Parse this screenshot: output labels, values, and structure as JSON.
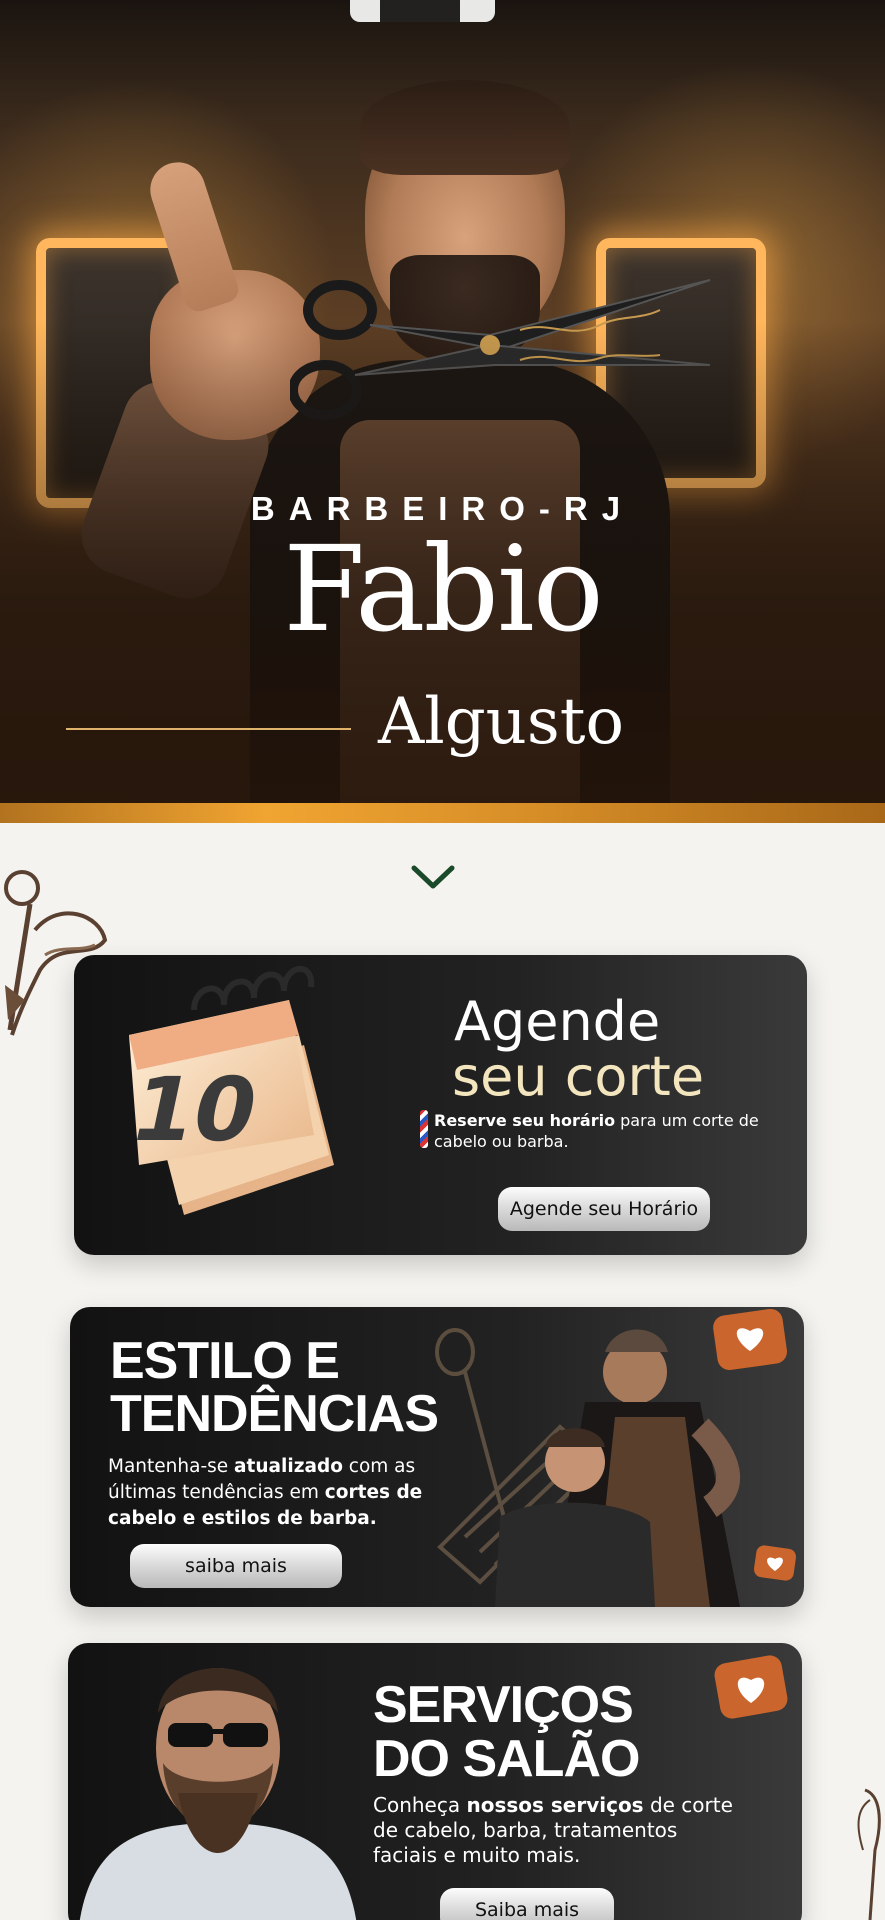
{
  "hero": {
    "kicker": "BARBEIRO-RJ",
    "title": "Fabio",
    "subtitle": "Algusto"
  },
  "scroll_indicator": {
    "icon": "chevron-down-icon",
    "color": "#1b4a2a"
  },
  "cards": {
    "schedule": {
      "calendar_number": "10",
      "title_line1": "Agende",
      "title_line2": "seu corte",
      "desc_bold": "Reserve seu horário",
      "desc_rest": " para um corte de cabelo ou barba.",
      "button": "Agende seu Horário"
    },
    "trends": {
      "title_line1": "ESTILO E",
      "title_line2": "TENDÊNCIAS",
      "desc_part1": "Mantenha-se ",
      "desc_bold1": "atualizado",
      "desc_part2": " com as últimas tendências em ",
      "desc_bold2": "cortes de cabelo e estilos de barba.",
      "button": "saiba mais"
    },
    "services": {
      "title_line1": "SERVIÇOS",
      "title_line2": "DO SALÃO",
      "desc_part1": "Conheça ",
      "desc_bold": "nossos serviços",
      "desc_part2": " de corte de cabelo, barba, tratamentos faciais e muito mais.",
      "button": "Saiba mais"
    }
  },
  "colors": {
    "accent_gold": "#f0a431",
    "card_dark": "#1a1a1a",
    "cream": "#f3e6bf",
    "heart_badge": "#c9652d"
  }
}
